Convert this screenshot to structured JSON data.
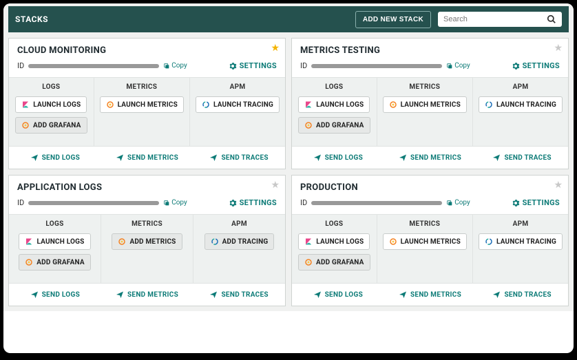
{
  "header": {
    "title": "STACKS",
    "add_button": "ADD NEW STACK",
    "search_placeholder": "Search"
  },
  "labels": {
    "id": "ID",
    "copy": "Copy",
    "settings": "SETTINGS",
    "logs_h": "LOGS",
    "metrics_h": "METRICS",
    "apm_h": "APM",
    "launch_logs": "LAUNCH LOGS",
    "add_grafana": "ADD GRAFANA",
    "launch_metrics": "LAUNCH METRICS",
    "add_metrics": "ADD METRICS",
    "launch_tracing": "LAUNCH TRACING",
    "add_tracing": "ADD TRACING",
    "send_logs": "SEND LOGS",
    "send_metrics": "SEND METRICS",
    "send_traces": "SEND TRACES"
  },
  "stacks": [
    {
      "title": "CLOUD MONITORING",
      "fav": true,
      "metrics": "launch",
      "tracing": "launch"
    },
    {
      "title": "METRICS TESTING",
      "fav": false,
      "metrics": "launch",
      "tracing": "launch"
    },
    {
      "title": "APPLICATION LOGS",
      "fav": false,
      "metrics": "add",
      "tracing": "add"
    },
    {
      "title": "PRODUCTION",
      "fav": false,
      "metrics": "launch",
      "tracing": "launch"
    }
  ]
}
